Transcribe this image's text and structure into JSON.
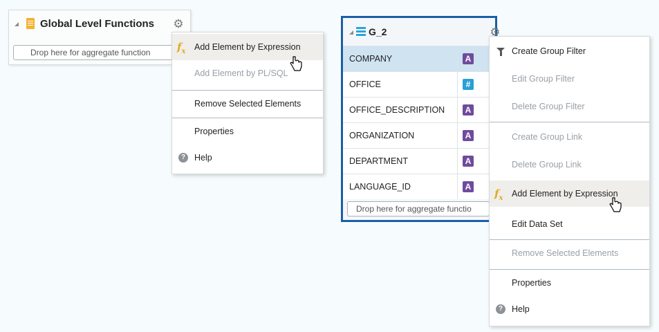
{
  "global_panel": {
    "title": "Global Level Functions",
    "drop_placeholder": "Drop here for aggregate function"
  },
  "global_menu": {
    "items": [
      {
        "label": "Add Element by Expression",
        "enabled": true,
        "hovered": true,
        "icon": "fx-icon"
      },
      {
        "label": "Add Element by PL/SQL",
        "enabled": false
      },
      {
        "label": "Remove Selected Elements",
        "enabled": true
      },
      {
        "label": "Properties",
        "enabled": true
      },
      {
        "label": "Help",
        "enabled": true,
        "icon": "help-icon"
      }
    ]
  },
  "group_panel": {
    "title": "G_2",
    "rows": [
      {
        "name": "COMPANY",
        "type": "A",
        "kind": "alpha"
      },
      {
        "name": "OFFICE",
        "type": "#",
        "kind": "number"
      },
      {
        "name": "OFFICE_DESCRIPTION",
        "type": "A",
        "kind": "alpha"
      },
      {
        "name": "ORGANIZATION",
        "type": "A",
        "kind": "alpha"
      },
      {
        "name": "DEPARTMENT",
        "type": "A",
        "kind": "alpha"
      },
      {
        "name": "LANGUAGE_ID",
        "type": "A",
        "kind": "alpha"
      }
    ],
    "drop_placeholder": "Drop here for aggregate functio"
  },
  "group_menu": {
    "items": [
      {
        "label": "Create Group Filter",
        "enabled": true,
        "icon": "filter-icon"
      },
      {
        "label": "Edit Group Filter",
        "enabled": false
      },
      {
        "label": "Delete Group Filter",
        "enabled": false
      },
      {
        "label": "Create Group Link",
        "enabled": false
      },
      {
        "label": "Delete Group Link",
        "enabled": false
      },
      {
        "label": "Add Element by Expression",
        "enabled": true,
        "hovered": true,
        "icon": "fx-icon"
      },
      {
        "label": "Edit Data Set",
        "enabled": true
      },
      {
        "label": "Remove Selected Elements",
        "enabled": false
      },
      {
        "label": "Properties",
        "enabled": true
      },
      {
        "label": "Help",
        "enabled": true,
        "icon": "help-icon"
      }
    ]
  },
  "colors": {
    "selected_row": "#cfe3f1",
    "panel_border": "#1a5ea8",
    "alpha_badge": "#6f4b9e",
    "number_badge": "#2a9fd8",
    "fx_icon": "#e3a91f",
    "menu_hover": "#efeeea"
  }
}
